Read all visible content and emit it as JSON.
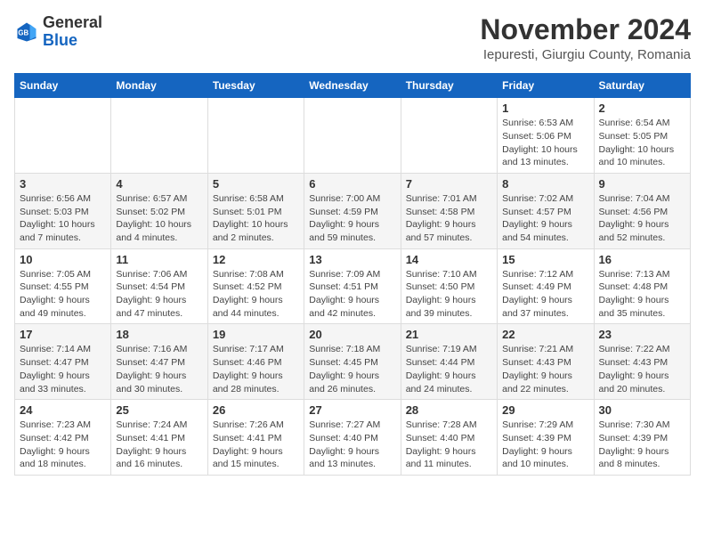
{
  "header": {
    "logo": {
      "general": "General",
      "blue": "Blue"
    },
    "title": "November 2024",
    "location": "Iepuresti, Giurgiu County, Romania"
  },
  "calendar": {
    "weekdays": [
      "Sunday",
      "Monday",
      "Tuesday",
      "Wednesday",
      "Thursday",
      "Friday",
      "Saturday"
    ],
    "weeks": [
      [
        {
          "day": "",
          "info": ""
        },
        {
          "day": "",
          "info": ""
        },
        {
          "day": "",
          "info": ""
        },
        {
          "day": "",
          "info": ""
        },
        {
          "day": "",
          "info": ""
        },
        {
          "day": "1",
          "info": "Sunrise: 6:53 AM\nSunset: 5:06 PM\nDaylight: 10 hours\nand 13 minutes."
        },
        {
          "day": "2",
          "info": "Sunrise: 6:54 AM\nSunset: 5:05 PM\nDaylight: 10 hours\nand 10 minutes."
        }
      ],
      [
        {
          "day": "3",
          "info": "Sunrise: 6:56 AM\nSunset: 5:03 PM\nDaylight: 10 hours\nand 7 minutes."
        },
        {
          "day": "4",
          "info": "Sunrise: 6:57 AM\nSunset: 5:02 PM\nDaylight: 10 hours\nand 4 minutes."
        },
        {
          "day": "5",
          "info": "Sunrise: 6:58 AM\nSunset: 5:01 PM\nDaylight: 10 hours\nand 2 minutes."
        },
        {
          "day": "6",
          "info": "Sunrise: 7:00 AM\nSunset: 4:59 PM\nDaylight: 9 hours\nand 59 minutes."
        },
        {
          "day": "7",
          "info": "Sunrise: 7:01 AM\nSunset: 4:58 PM\nDaylight: 9 hours\nand 57 minutes."
        },
        {
          "day": "8",
          "info": "Sunrise: 7:02 AM\nSunset: 4:57 PM\nDaylight: 9 hours\nand 54 minutes."
        },
        {
          "day": "9",
          "info": "Sunrise: 7:04 AM\nSunset: 4:56 PM\nDaylight: 9 hours\nand 52 minutes."
        }
      ],
      [
        {
          "day": "10",
          "info": "Sunrise: 7:05 AM\nSunset: 4:55 PM\nDaylight: 9 hours\nand 49 minutes."
        },
        {
          "day": "11",
          "info": "Sunrise: 7:06 AM\nSunset: 4:54 PM\nDaylight: 9 hours\nand 47 minutes."
        },
        {
          "day": "12",
          "info": "Sunrise: 7:08 AM\nSunset: 4:52 PM\nDaylight: 9 hours\nand 44 minutes."
        },
        {
          "day": "13",
          "info": "Sunrise: 7:09 AM\nSunset: 4:51 PM\nDaylight: 9 hours\nand 42 minutes."
        },
        {
          "day": "14",
          "info": "Sunrise: 7:10 AM\nSunset: 4:50 PM\nDaylight: 9 hours\nand 39 minutes."
        },
        {
          "day": "15",
          "info": "Sunrise: 7:12 AM\nSunset: 4:49 PM\nDaylight: 9 hours\nand 37 minutes."
        },
        {
          "day": "16",
          "info": "Sunrise: 7:13 AM\nSunset: 4:48 PM\nDaylight: 9 hours\nand 35 minutes."
        }
      ],
      [
        {
          "day": "17",
          "info": "Sunrise: 7:14 AM\nSunset: 4:47 PM\nDaylight: 9 hours\nand 33 minutes."
        },
        {
          "day": "18",
          "info": "Sunrise: 7:16 AM\nSunset: 4:47 PM\nDaylight: 9 hours\nand 30 minutes."
        },
        {
          "day": "19",
          "info": "Sunrise: 7:17 AM\nSunset: 4:46 PM\nDaylight: 9 hours\nand 28 minutes."
        },
        {
          "day": "20",
          "info": "Sunrise: 7:18 AM\nSunset: 4:45 PM\nDaylight: 9 hours\nand 26 minutes."
        },
        {
          "day": "21",
          "info": "Sunrise: 7:19 AM\nSunset: 4:44 PM\nDaylight: 9 hours\nand 24 minutes."
        },
        {
          "day": "22",
          "info": "Sunrise: 7:21 AM\nSunset: 4:43 PM\nDaylight: 9 hours\nand 22 minutes."
        },
        {
          "day": "23",
          "info": "Sunrise: 7:22 AM\nSunset: 4:43 PM\nDaylight: 9 hours\nand 20 minutes."
        }
      ],
      [
        {
          "day": "24",
          "info": "Sunrise: 7:23 AM\nSunset: 4:42 PM\nDaylight: 9 hours\nand 18 minutes."
        },
        {
          "day": "25",
          "info": "Sunrise: 7:24 AM\nSunset: 4:41 PM\nDaylight: 9 hours\nand 16 minutes."
        },
        {
          "day": "26",
          "info": "Sunrise: 7:26 AM\nSunset: 4:41 PM\nDaylight: 9 hours\nand 15 minutes."
        },
        {
          "day": "27",
          "info": "Sunrise: 7:27 AM\nSunset: 4:40 PM\nDaylight: 9 hours\nand 13 minutes."
        },
        {
          "day": "28",
          "info": "Sunrise: 7:28 AM\nSunset: 4:40 PM\nDaylight: 9 hours\nand 11 minutes."
        },
        {
          "day": "29",
          "info": "Sunrise: 7:29 AM\nSunset: 4:39 PM\nDaylight: 9 hours\nand 10 minutes."
        },
        {
          "day": "30",
          "info": "Sunrise: 7:30 AM\nSunset: 4:39 PM\nDaylight: 9 hours\nand 8 minutes."
        }
      ]
    ]
  }
}
